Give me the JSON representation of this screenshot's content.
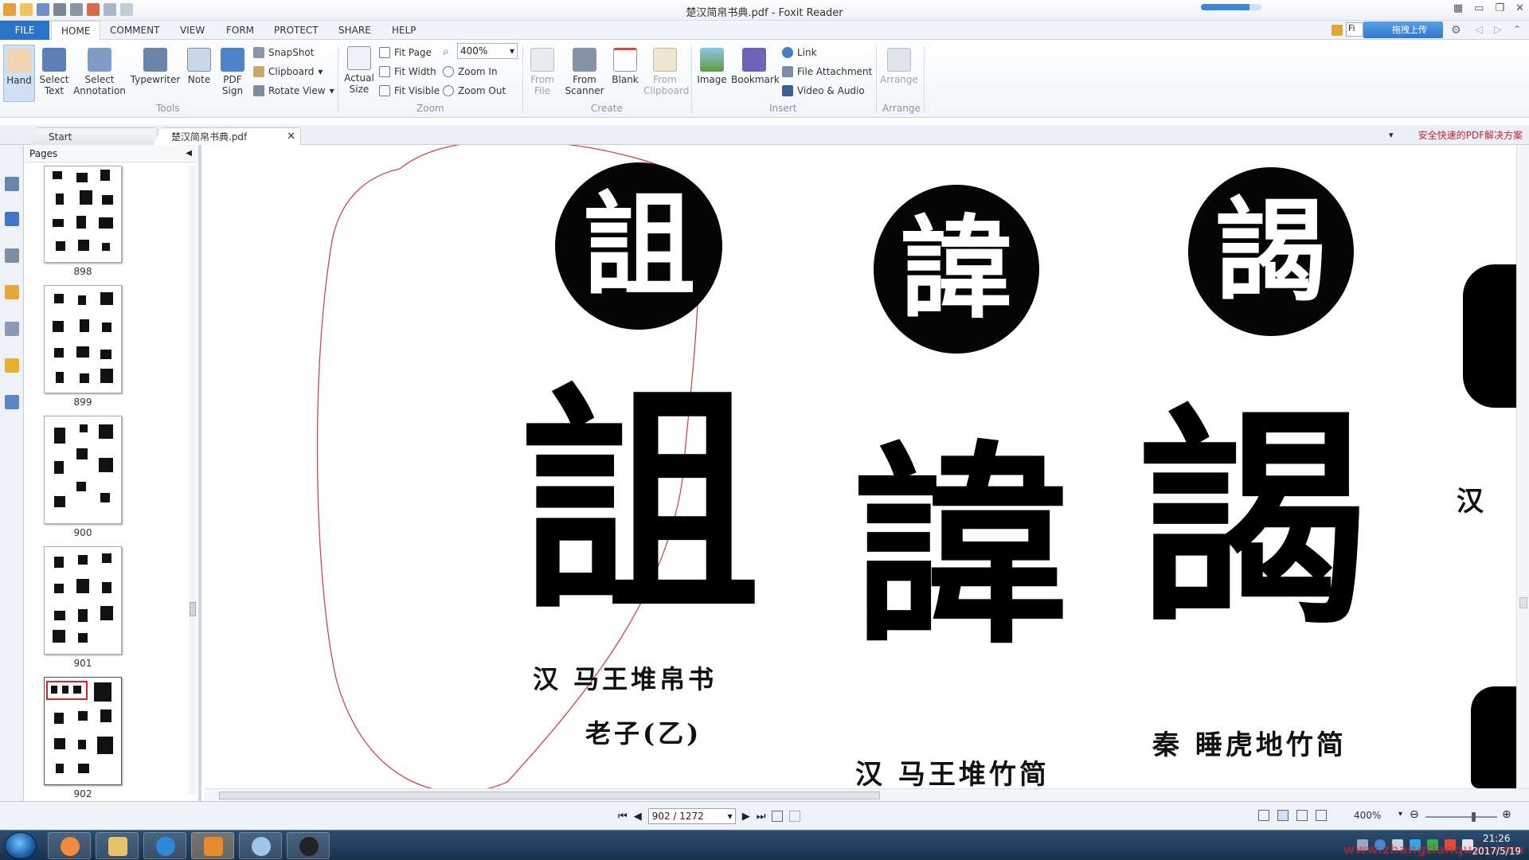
{
  "app": {
    "title": "楚汉简帛书典.pdf - Foxit Reader",
    "download_progress": 0.8
  },
  "menu": {
    "tabs": [
      {
        "label": "FILE"
      },
      {
        "label": "HOME"
      },
      {
        "label": "COMMENT"
      },
      {
        "label": "VIEW"
      },
      {
        "label": "FORM"
      },
      {
        "label": "PROTECT"
      },
      {
        "label": "SHARE"
      },
      {
        "label": "HELP"
      }
    ],
    "search_placeholder": "Fi",
    "cloud_button": "拖拽上传"
  },
  "ribbon": {
    "tools": {
      "hand": "Hand",
      "select_text": "Select Text",
      "select_annotation": "Select Annotation",
      "typewriter": "Typewriter",
      "note": "Note",
      "pdf_sign": "PDF Sign",
      "snapshot": "SnapShot",
      "clipboard": "Clipboard",
      "rotate_view": "Rotate View",
      "group": "Tools"
    },
    "zoom": {
      "actual_size": "Actual Size",
      "fit_page": "Fit Page",
      "fit_width": "Fit Width",
      "fit_visible": "Fit Visible",
      "zoom_value": "400%",
      "zoom_in": "Zoom In",
      "zoom_out": "Zoom Out",
      "group": "Zoom"
    },
    "create": {
      "from_file": "From File",
      "from_scanner": "From Scanner",
      "blank": "Blank",
      "from_clipboard": "From Clipboard",
      "group": "Create"
    },
    "insert": {
      "image": "Image",
      "bookmark": "Bookmark",
      "link": "Link",
      "file_attachment": "File Attachment",
      "video_audio": "Video & Audio",
      "group": "Insert"
    },
    "arrange": {
      "arrange": "Arrange",
      "group": "Arrange"
    }
  },
  "doc_tabs": {
    "start": "Start",
    "file": "楚汉简帛书典.pdf",
    "promo": "安全快速的PDF解决方案"
  },
  "pages_panel": {
    "title": "Pages",
    "thumbs": [
      {
        "label": "898"
      },
      {
        "label": "899"
      },
      {
        "label": "900"
      },
      {
        "label": "901"
      },
      {
        "label": "902"
      }
    ]
  },
  "document": {
    "entries": [
      {
        "seal": "詛",
        "glyph": "詛",
        "caption1": "汉 马王堆帛书",
        "caption2": "老子(乙)"
      },
      {
        "seal": "諱",
        "glyph": "諱",
        "caption1": "汉 马王堆竹简"
      },
      {
        "seal": "謁",
        "glyph": "謁",
        "caption1": "秦 睡虎地竹简"
      },
      {
        "side_label": "汉"
      }
    ]
  },
  "status": {
    "page_indicator": "902 / 1272",
    "zoom": "400%"
  },
  "taskbar": {
    "time": "21:26",
    "date": "2017/5/19",
    "watermark": "www.zhangtianquan.com"
  }
}
